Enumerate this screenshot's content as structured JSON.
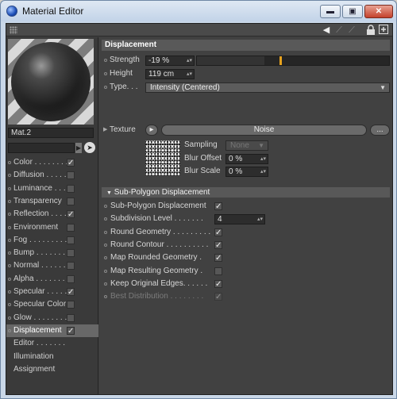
{
  "window": {
    "title": "Material Editor",
    "minimize": "▬",
    "maximize": "▣",
    "close": "✕"
  },
  "toolbar": {
    "icons": [
      "arrow-left-icon",
      "arrow-up-icon",
      "arrow-right-icon",
      "lock-icon",
      "new-panel-icon"
    ]
  },
  "material": {
    "name": "Mat.2"
  },
  "channels": [
    {
      "label": "Color . . . . . . . .",
      "checked": true
    },
    {
      "label": "Diffusion . . . . .",
      "checked": false
    },
    {
      "label": "Luminance . . . .",
      "checked": false
    },
    {
      "label": "Transparency",
      "checked": false
    },
    {
      "label": "Reflection . . . .",
      "checked": true
    },
    {
      "label": "Environment",
      "checked": false
    },
    {
      "label": "Fog . . . . . . . . .",
      "checked": false
    },
    {
      "label": "Bump . . . . . . . .",
      "checked": false
    },
    {
      "label": "Normal . . . . . . .",
      "checked": false
    },
    {
      "label": "Alpha . . . . . . . .",
      "checked": false
    },
    {
      "label": "Specular . . . . .",
      "checked": true
    },
    {
      "label": "Specular Color",
      "checked": false
    },
    {
      "label": "Glow . . . . . . . . .",
      "checked": false
    },
    {
      "label": "Displacement",
      "checked": true,
      "selected": true
    }
  ],
  "extra_items": [
    "Editor . . . . . . .",
    "Illumination",
    "Assignment"
  ],
  "displacement": {
    "header": "Displacement",
    "strength_label": "Strength",
    "strength_value": "-19 %",
    "strength_fraction": 0.35,
    "height_label": "Height",
    "height_value": "119 cm",
    "type_label": "Type. . .",
    "type_value": "Intensity (Centered)",
    "texture_label": "Texture",
    "texture_value": "Noise",
    "texture_more": "...",
    "sampling_label": "Sampling",
    "sampling_value": "None",
    "blur_offset_label": "Blur Offset",
    "blur_offset_value": "0 %",
    "blur_scale_label": "Blur Scale",
    "blur_scale_value": "0 %"
  },
  "subpoly": {
    "header": "Sub-Polygon Displacement",
    "rows": [
      {
        "label": "Sub-Polygon Displacement",
        "checked": true
      },
      {
        "label": "Subdivision Level . . . . . . .",
        "value": "4"
      },
      {
        "label": "Round Geometry . . . . . . . . .",
        "checked": true
      },
      {
        "label": "Round Contour . . . . . . . . . .",
        "checked": true
      },
      {
        "label": "Map Rounded Geometry .",
        "checked": true
      },
      {
        "label": "Map Resulting Geometry .",
        "checked": false
      },
      {
        "label": "Keep Original Edges. . . . . .",
        "checked": true
      },
      {
        "label": "Best Distribution . . . . . . . .",
        "checked": true,
        "disabled": true
      }
    ]
  }
}
